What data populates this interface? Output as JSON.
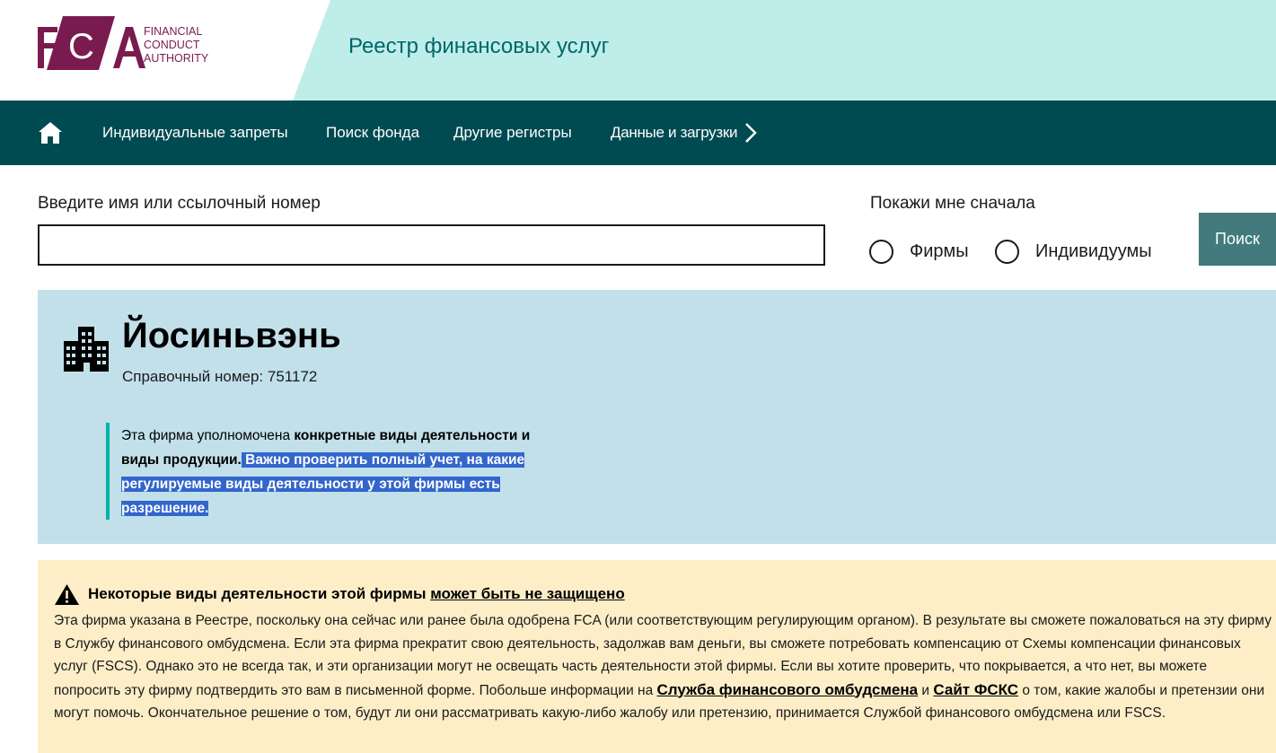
{
  "header": {
    "logo_letters": "FCA",
    "logo_line1": "FINANCIAL",
    "logo_line2": "CONDUCT",
    "logo_line3": "AUTHORITY",
    "site_title": "Реестр финансовых услуг",
    "colors": {
      "logo": "#7a1b4f",
      "band_left": "#ffffff",
      "band_right": "#bfeeea"
    }
  },
  "nav": {
    "home_icon": "home-icon",
    "items": [
      {
        "label": "Индивидуальные запреты"
      },
      {
        "label": "Поиск фонда"
      },
      {
        "label": "Другие регистры"
      },
      {
        "label": "Данные и загрузки"
      }
    ],
    "more_icon": "chevron-right-icon",
    "color": "#004a52"
  },
  "search": {
    "label": "Введите имя или ссылочный номер",
    "value": "",
    "placeholder": "",
    "show_first_label": "Покажи мне сначала",
    "options": [
      {
        "label": "Фирмы",
        "selected": false
      },
      {
        "label": "Индивидуумы",
        "selected": false
      }
    ],
    "button_label": "Поиск"
  },
  "firm": {
    "icon": "building-icon",
    "name": "Йосиньвэнь",
    "ref_label": "Справочный номер: 751172",
    "callout_prefix": "Эта фирма уполномочена ",
    "callout_bold": "конкретные виды деятельности и виды продукции.",
    "callout_highlight": " Важно проверить полный учет, на какие регулируемые виды деятельности у этой фирмы есть разрешение."
  },
  "warning": {
    "icon": "warning-triangle-icon",
    "title": "Некоторые виды деятельности этой фирмы ",
    "title_link": "может быть не защищено",
    "body_part1": "Эта фирма указана в Реестре, поскольку она сейчас или ранее была одобрена FCA (или соответствующим регулирующим органом). В результате вы сможете пожаловаться на эту фирму в Службу финансового омбудсмена. Если эта фирма прекратит свою деятельность, задолжав вам деньги, вы сможете потребовать компенсацию от Схемы компенсации финансовых услуг (FSCS). Однако это не всегда так, и эти организации могут не освещать часть деятельности этой фирмы. Если вы хотите проверить, что покрывается, а что нет, вы можете попросить эту фирму подтвердить это вам в письменной форме. Побольше информации на ",
    "link1": "Служба финансового омбудсмена",
    "body_and": " и ",
    "link2": "Сайт ФСКС",
    "body_part2": " о том, какие жалобы и претензии они могут помочь. Окончательное решение о том, будут ли они рассматривать какую-либо жалобу или претензию, принимается Службой финансового омбудсмена или FSCS."
  }
}
